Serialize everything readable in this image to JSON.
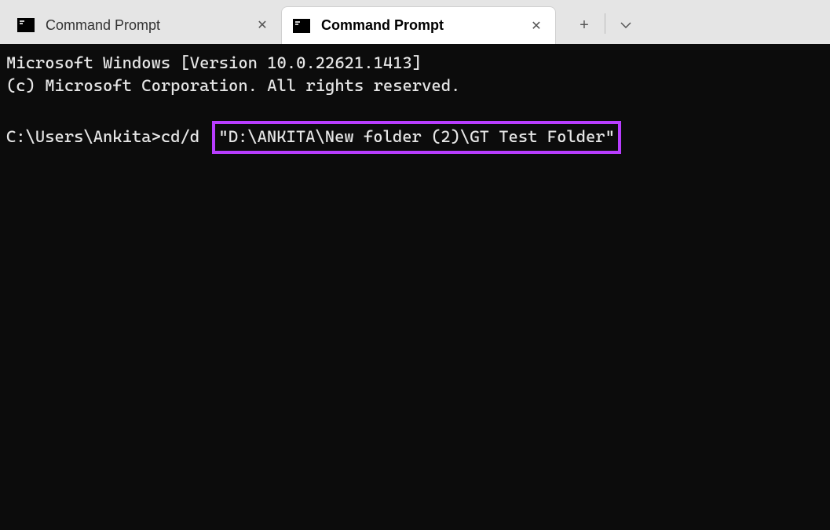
{
  "tabs": [
    {
      "title": "Command Prompt",
      "active": false
    },
    {
      "title": "Command Prompt",
      "active": true
    }
  ],
  "terminal": {
    "line1": "Microsoft Windows [Version 10.0.22621.1413]",
    "line2": "(c) Microsoft Corporation. All rights reserved.",
    "prompt": "C:\\Users\\Ankita>",
    "command": "cd/d",
    "highlighted_path": "\"D:\\ANKITA\\New folder (2)\\GT Test Folder\""
  },
  "colors": {
    "highlight": "#b83dff"
  }
}
